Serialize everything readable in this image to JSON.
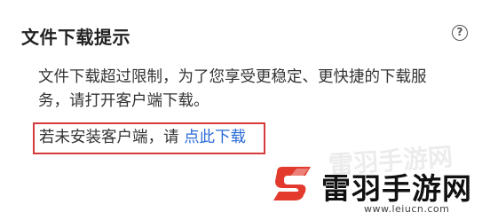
{
  "dialog": {
    "title": "文件下载提示",
    "help_icon": "question-circle-icon",
    "message": "文件下载超过限制，为了您享受更稳定、更快捷的下载服务，请打开客户端下载。",
    "prompt_text": "若未安装客户端，请 ",
    "download_link": "点此下载",
    "colors": {
      "link": "#2a6ad6",
      "highlight_border": "#d63a3a",
      "text": "#333333"
    }
  },
  "watermark": {
    "name": "雷羽手游网",
    "url": "www.leiucn.com",
    "logo_icon": "leiyu-logo-icon"
  }
}
